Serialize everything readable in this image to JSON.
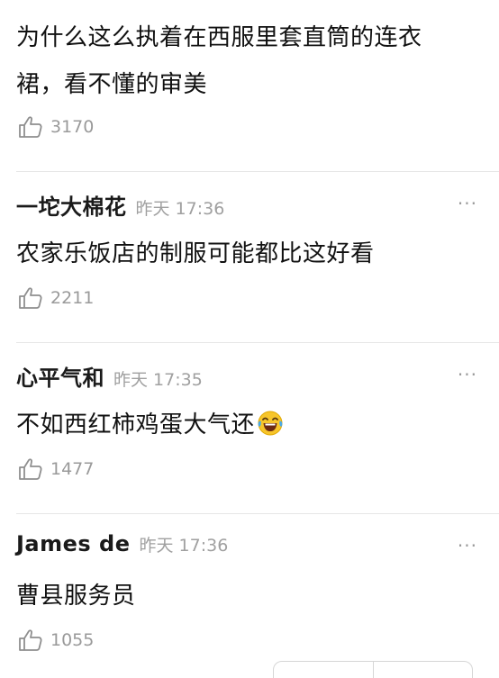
{
  "comments": [
    {
      "content_line1": "为什么这么执着在西服里套直筒的连衣",
      "content_line2": "裙，看不懂的审美",
      "likes": "3170"
    },
    {
      "username": "一坨大棉花",
      "time": "昨天 17:36",
      "content": "农家乐饭店的制服可能都比这好看",
      "likes": "2211",
      "more": "···"
    },
    {
      "username": "心平气和",
      "time": "昨天 17:35",
      "content": "不如西红柿鸡蛋大气还",
      "emoji": "laughing-tears-emoji",
      "likes": "1477",
      "more": "···"
    },
    {
      "username": "James de",
      "time": "昨天 17:36",
      "content": "曹县服务员",
      "likes": "1055",
      "more": "···"
    }
  ],
  "icons": {
    "like": "thumbs-up-icon",
    "more": "more-dots-icon"
  },
  "colors": {
    "text_primary": "#111111",
    "text_secondary": "#9a9a9a",
    "divider": "#e6e6e6",
    "background": "#ffffff"
  }
}
